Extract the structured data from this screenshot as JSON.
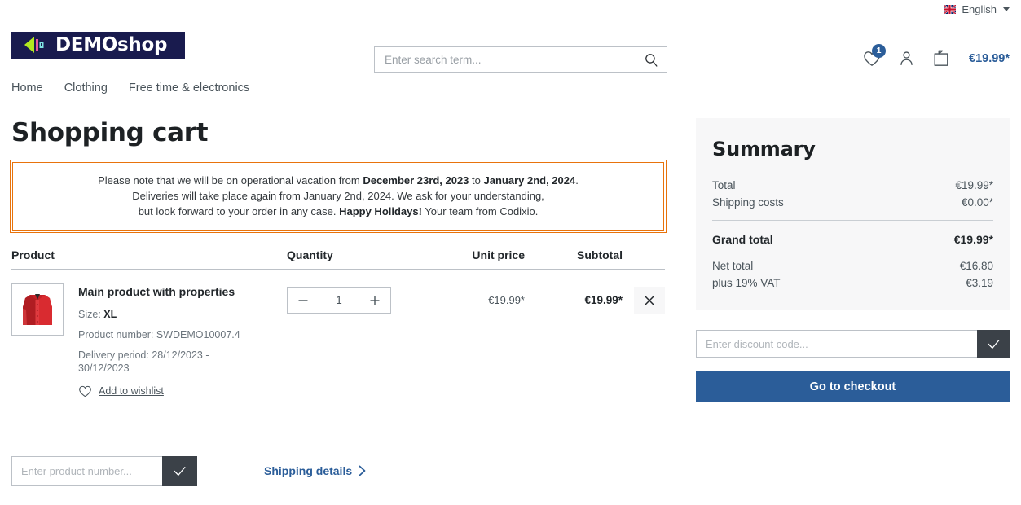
{
  "topbar": {
    "language": "English",
    "flag_icon": "uk-flag-icon",
    "caret_icon": "chevron-down-icon"
  },
  "header": {
    "logo_text": "DEMOshop",
    "search": {
      "placeholder": "Enter search term...",
      "value": "",
      "icon": "search-icon"
    },
    "wishlist": {
      "icon": "heart-icon",
      "badge": "1"
    },
    "account": {
      "icon": "user-icon"
    },
    "cart": {
      "icon": "bag-icon",
      "price": "€19.99*"
    }
  },
  "nav": {
    "items": [
      {
        "label": "Home"
      },
      {
        "label": "Clothing"
      },
      {
        "label": "Free time & electronics"
      }
    ]
  },
  "page": {
    "title": "Shopping cart"
  },
  "notice": {
    "line1_a": "Please note that we will be on operational vacation from ",
    "line1_b": "December 23rd, 2023",
    "line1_c": " to ",
    "line1_d": "January 2nd, 2024",
    "line1_e": ".",
    "line2": "Deliveries will take place again from January 2nd, 2024. We ask for your understanding,",
    "line3_a": "but look forward to your order in any case. ",
    "line3_b": "Happy Holidays!",
    "line3_c": " Your team from Codixio.",
    "border_color": "#e8730c"
  },
  "cart": {
    "columns": {
      "product": "Product",
      "quantity": "Quantity",
      "unit_price": "Unit price",
      "subtotal": "Subtotal"
    },
    "items": [
      {
        "thumb_alt": "red jacket product image",
        "name": "Main product with properties",
        "size_label": "Size: ",
        "size_value": "XL",
        "product_number": "Product number: SWDEMO10007.4",
        "delivery_period": "Delivery period: 28/12/2023 - 30/12/2023",
        "wishlist_label": "Add to wishlist",
        "wishlist_icon": "heart-icon",
        "quantity": "1",
        "minus_icon": "minus-icon",
        "plus_icon": "plus-icon",
        "unit_price": "€19.99*",
        "subtotal": "€19.99*",
        "remove_icon": "close-icon"
      }
    ]
  },
  "bottom": {
    "product_number_placeholder": "Enter product number...",
    "product_number_value": "",
    "submit_icon": "check-icon",
    "shipping_details_label": "Shipping details",
    "shipping_details_icon": "chevron-right-icon"
  },
  "summary": {
    "title": "Summary",
    "rows": [
      {
        "label": "Total",
        "value": "€19.99*"
      },
      {
        "label": "Shipping costs",
        "value": "€0.00*"
      }
    ],
    "grand": {
      "label": "Grand total",
      "value": "€19.99*"
    },
    "tax_rows": [
      {
        "label": "Net total",
        "value": "€16.80"
      },
      {
        "label": "plus 19% VAT",
        "value": "€3.19"
      }
    ],
    "discount": {
      "placeholder": "Enter discount code...",
      "value": "",
      "submit_icon": "check-icon"
    },
    "checkout_label": "Go to checkout"
  },
  "colors": {
    "brand_blue": "#2b5d99",
    "logo_navy": "#191b4e",
    "notice_orange": "#e8730c",
    "panel_gray": "#f7f7f8",
    "dark_button": "#3b4148"
  }
}
